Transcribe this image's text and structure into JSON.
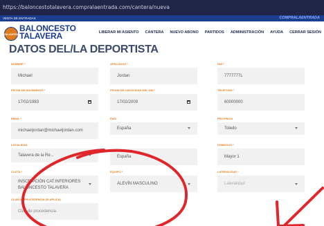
{
  "browser": {
    "url": "https://baloncestotalavera.compralaentrada.com/cantera/nueva"
  },
  "topstrip": {
    "left": "VENTA DE ENTRADAS",
    "right": "COMPRALAENTRADA"
  },
  "brand": {
    "line1": "BALONCESTO",
    "line2": "TALAVERA",
    "badge": "TALAVERA"
  },
  "nav": [
    "LIBERAR MI ASIENTO",
    "CANTERA",
    "NUEVO ABONO",
    "PARTIDOS",
    "ADMINISTRACIÓN",
    "AYUDA",
    "CERRAR SESIÓN"
  ],
  "page": {
    "title": "DATOS DEL/LA DEPORTISTA"
  },
  "fields": {
    "nombre": {
      "label": "NOMBRE *",
      "value": "Michael"
    },
    "apellidos": {
      "label": "APELLIDOS *",
      "value": "Jordan"
    },
    "dni": {
      "label": "DNI *",
      "value": "7777777L"
    },
    "fecha_nac": {
      "label": "FECHA DE NACIMIENTO *",
      "value": "17/02/1983"
    },
    "fecha_dni": {
      "label": "FECHA DE CADUCIDAD DEL DNI *",
      "value": "17/02/2009"
    },
    "telefono": {
      "label": "TELÉFONO *",
      "value": "60000000"
    },
    "email": {
      "label": "EMAIL *",
      "value": "michaeljordan@michaeljordan.com"
    },
    "pais": {
      "label": "PAÍS",
      "value": "España"
    },
    "provincia": {
      "label": "PROVINCIA",
      "value": "Toledo"
    },
    "localidad": {
      "label": "LOCALIDAD",
      "value": "Talavera de la Re..."
    },
    "pais2": {
      "label": "",
      "value": "España"
    },
    "domicilio": {
      "label": "DOMICILIO *",
      "value": "Mayor 1"
    },
    "cuota": {
      "label": "CUOTA *",
      "value": "INSCRIPCIÓN CAT.INFERIORES BALONCESTO TALAVERA"
    },
    "equipo": {
      "label": "EQUIPO *",
      "value": "ALEVÍN MASCULINO"
    },
    "lateralidad": {
      "label": "LATERALIDAD *",
      "value": "Lateralidad"
    },
    "club": {
      "label": "CLUB DE PROCEDENCIA (SI APLICA)",
      "placeholder": "Club de procedencia"
    }
  },
  "annotation_color": "#e0262b"
}
